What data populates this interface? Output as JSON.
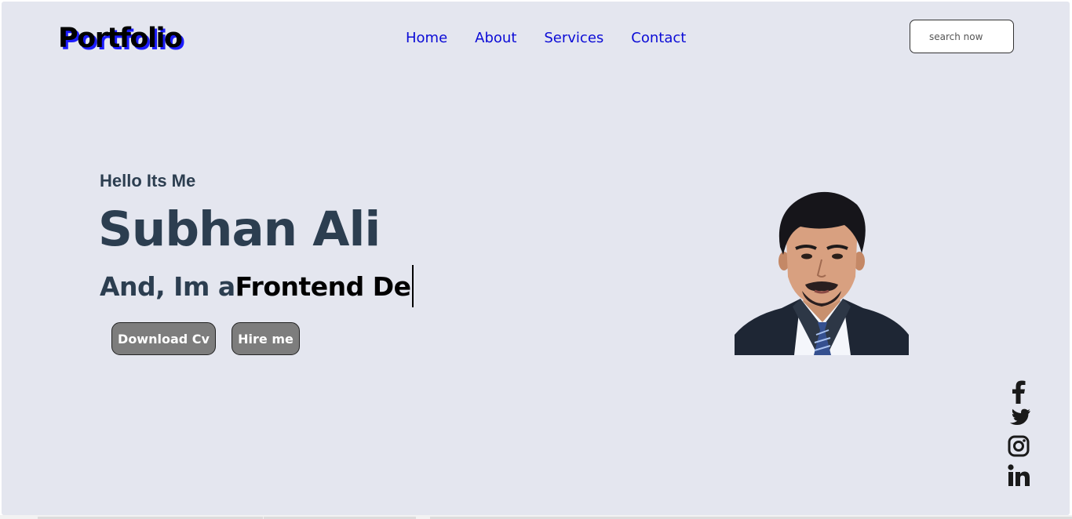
{
  "header": {
    "logo": "Portfolio",
    "nav": [
      "Home",
      "About",
      "Services",
      "Contact"
    ],
    "search_placeholder": "search now"
  },
  "hero": {
    "greeting": "Hello Its Me",
    "name": "Subhan Ali",
    "role_prefix": "And, Im a",
    "role_typed": "Frontend De",
    "buttons": {
      "download_cv": "Download Cv",
      "hire_me": "Hire me"
    }
  },
  "socials": [
    "facebook-icon",
    "twitter-icon",
    "instagram-icon",
    "linkedin-icon"
  ],
  "colors": {
    "background": "#e4e6ef",
    "nav": "#0b0bd6",
    "heading": "#2c3e50",
    "logo_shadow": "#1c1cff",
    "button": "#7d7d7d"
  }
}
